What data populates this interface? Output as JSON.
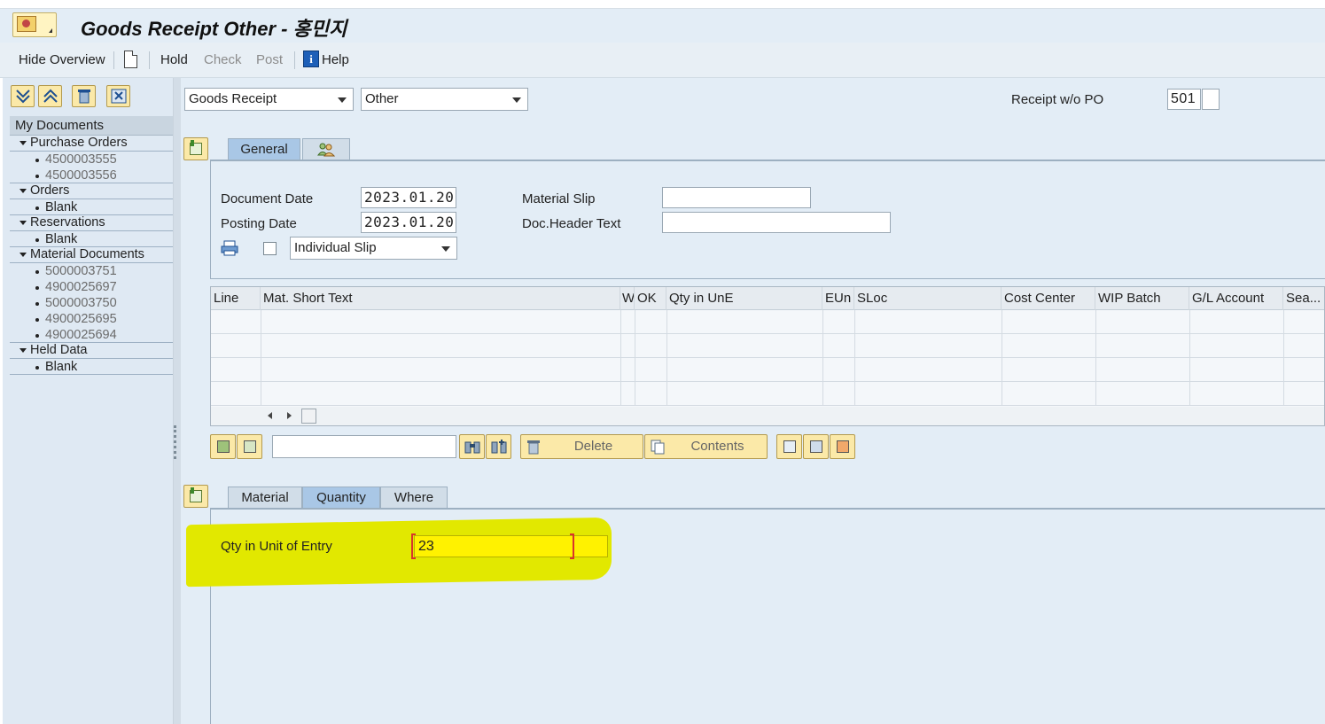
{
  "title": {
    "text": "Goods Receipt Other - 홍민지"
  },
  "toolbar": {
    "hide_overview": "Hide Overview",
    "hold": "Hold",
    "check": "Check",
    "post": "Post",
    "help": "Help"
  },
  "tree": {
    "header": "My Documents",
    "groups": [
      {
        "label": "Purchase Orders",
        "items": [
          "4500003555",
          "4500003556"
        ]
      },
      {
        "label": "Orders",
        "items": [
          "Blank"
        ]
      },
      {
        "label": "Reservations",
        "items": [
          "Blank"
        ]
      },
      {
        "label": "Material Documents",
        "items": [
          "5000003751",
          "4900025697",
          "5000003750",
          "4900025695",
          "4900025694"
        ]
      },
      {
        "label": "Held Data",
        "items": [
          "Blank"
        ]
      }
    ]
  },
  "header_fields": {
    "transaction": "Goods Receipt",
    "reference": "Other",
    "movement_label": "Receipt w/o PO",
    "movement_type": "501"
  },
  "general_tabs": [
    "General"
  ],
  "general": {
    "document_date_label": "Document Date",
    "document_date": "2023.01.20",
    "posting_date_label": "Posting Date",
    "posting_date": "2023.01.20",
    "material_slip_label": "Material Slip",
    "material_slip": "",
    "doc_header_label": "Doc.Header Text",
    "doc_header": "",
    "slip_type": "Individual Slip"
  },
  "table": {
    "columns": [
      "Line",
      "Mat. Short Text",
      "W",
      "OK",
      "Qty in UnE",
      "EUn",
      "SLoc",
      "Cost Center",
      "WIP Batch",
      "G/L Account",
      "Sea..."
    ],
    "rows": [
      [],
      [],
      [],
      []
    ]
  },
  "item_toolbar": {
    "delete": "Delete",
    "contents": "Contents"
  },
  "detail_tabs": [
    "Material",
    "Quantity",
    "Where"
  ],
  "detail": {
    "qty_label": "Qty in Unit of Entry",
    "qty_value": "23"
  },
  "colors": {
    "highlight": "#e2e800",
    "active_tab": "#a9c7e6",
    "background": "#e3edf6"
  }
}
